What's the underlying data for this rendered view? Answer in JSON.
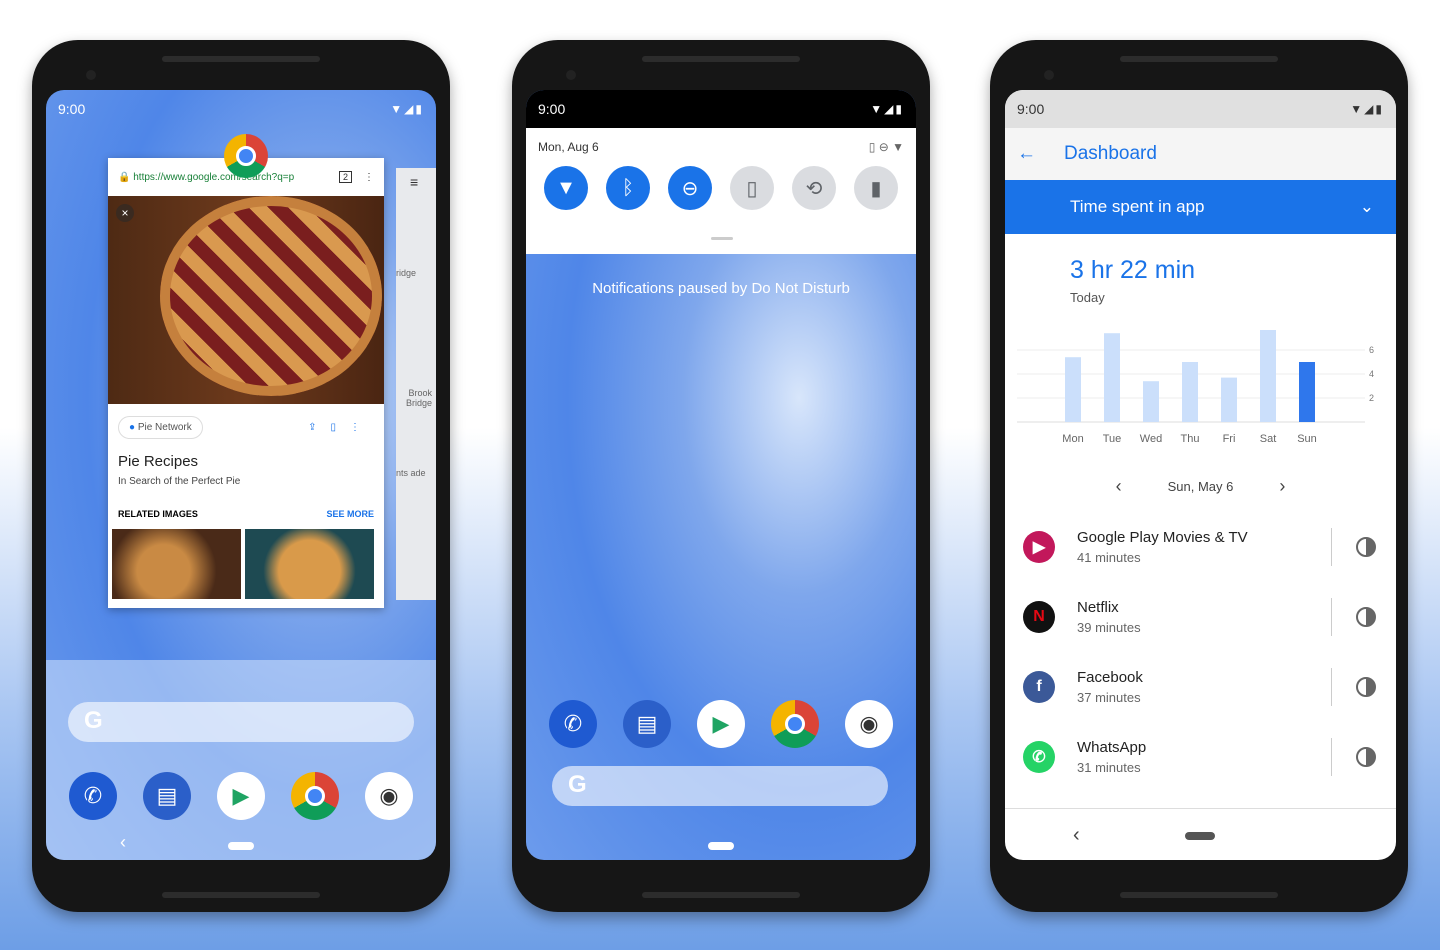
{
  "phone1": {
    "time": "9:00",
    "url": "https://www.google.com/search?q=p",
    "tab_count": "2",
    "source": "Pie Network",
    "title": "Pie Recipes",
    "subtitle": "In Search of the Perfect Pie",
    "related": "RELATED IMAGES",
    "see_more": "SEE MORE",
    "map_labels": [
      "ridge",
      "Brook Bridge",
      "nts ade"
    ],
    "search_g": "G",
    "back": "‹"
  },
  "phone2": {
    "time": "9:00",
    "date": "Mon, Aug 6",
    "notice": "Notifications paused by Do Not Disturb",
    "tiles": [
      "wifi",
      "bluetooth",
      "do-not-disturb",
      "flashlight",
      "auto-rotate",
      "battery-saver"
    ],
    "search_g": "G"
  },
  "phone3": {
    "time": "9:00",
    "title": "Dashboard",
    "dropdown": "Time spent in app",
    "total": "3 hr 22 min",
    "period": "Today",
    "date": "Sun, May 6",
    "apps": [
      {
        "name": "Google Play Movies & TV",
        "time": "41 minutes"
      },
      {
        "name": "Netflix",
        "time": "39 minutes"
      },
      {
        "name": "Facebook",
        "time": "37 minutes"
      },
      {
        "name": "WhatsApp",
        "time": "31 minutes"
      }
    ],
    "back": "‹"
  },
  "colors": {
    "accent": "#1a73e8",
    "bar_light": "#cbdffb",
    "bar_active": "#2f77ec"
  },
  "chart_data": {
    "type": "bar",
    "categories": [
      "Mon",
      "Tue",
      "Wed",
      "Thu",
      "Fri",
      "Sat",
      "Sun"
    ],
    "values": [
      5.4,
      7.4,
      3.4,
      5.0,
      3.7,
      8.1,
      5.0
    ],
    "yticks": [
      "2",
      "4",
      "6",
      "8"
    ],
    "ylim": [
      0,
      8
    ],
    "highlight": "Sun",
    "grid": true
  }
}
